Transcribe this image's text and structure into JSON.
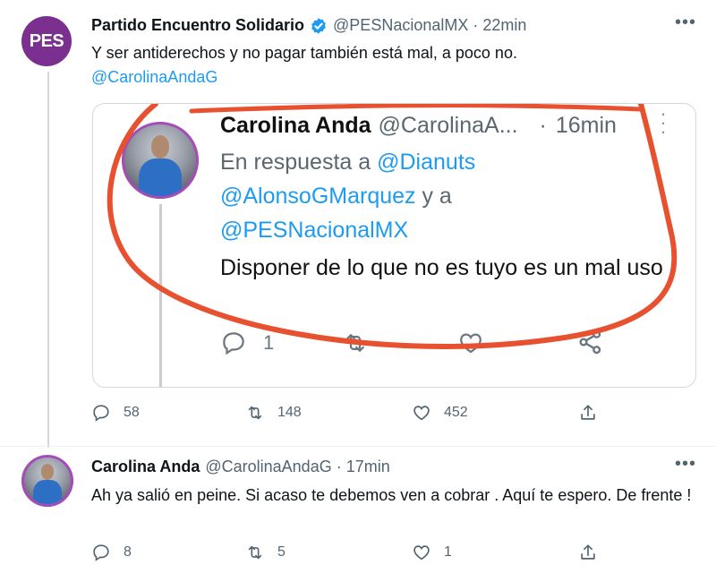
{
  "tweet1": {
    "name": "Partido Encuentro Solidario",
    "handle": "@PESNacionalMX",
    "dot": "·",
    "time": "22min",
    "avatar_text": "PES",
    "text": "Y ser antiderechos y no pagar también está mal, a poco no.",
    "mention": "@CarolinaAndaG",
    "replies": "58",
    "retweets": "148",
    "likes": "452"
  },
  "quote": {
    "name": "Carolina Anda",
    "handle": "@CarolinaA...",
    "dot": "·",
    "time": "16min",
    "reply_prefix": "En respuesta a",
    "reply_mention1": "@Dianuts",
    "reply_mention2": "@AlonsoGMarquez",
    "reply_and": "y a",
    "reply_mention3": "@PESNacionalMX",
    "text": "Disponer de lo que no es tuyo es un mal uso",
    "replies": "1"
  },
  "tweet2": {
    "name": "Carolina Anda",
    "handle": "@CarolinaAndaG",
    "dot": "·",
    "time": "17min",
    "text": "Ah ya salió en peine. Si acaso te debemos ven a cobrar . Aquí te espero. De frente !",
    "replies": "8",
    "retweets": "5",
    "likes": "1"
  },
  "colors": {
    "accent": "#1d9bf0",
    "pes_purple": "#7b2f8f",
    "annotation_red": "#e8512f"
  },
  "icons": [
    "verified-icon",
    "more-icon",
    "reply-icon",
    "retweet-icon",
    "like-icon",
    "share-icon"
  ]
}
